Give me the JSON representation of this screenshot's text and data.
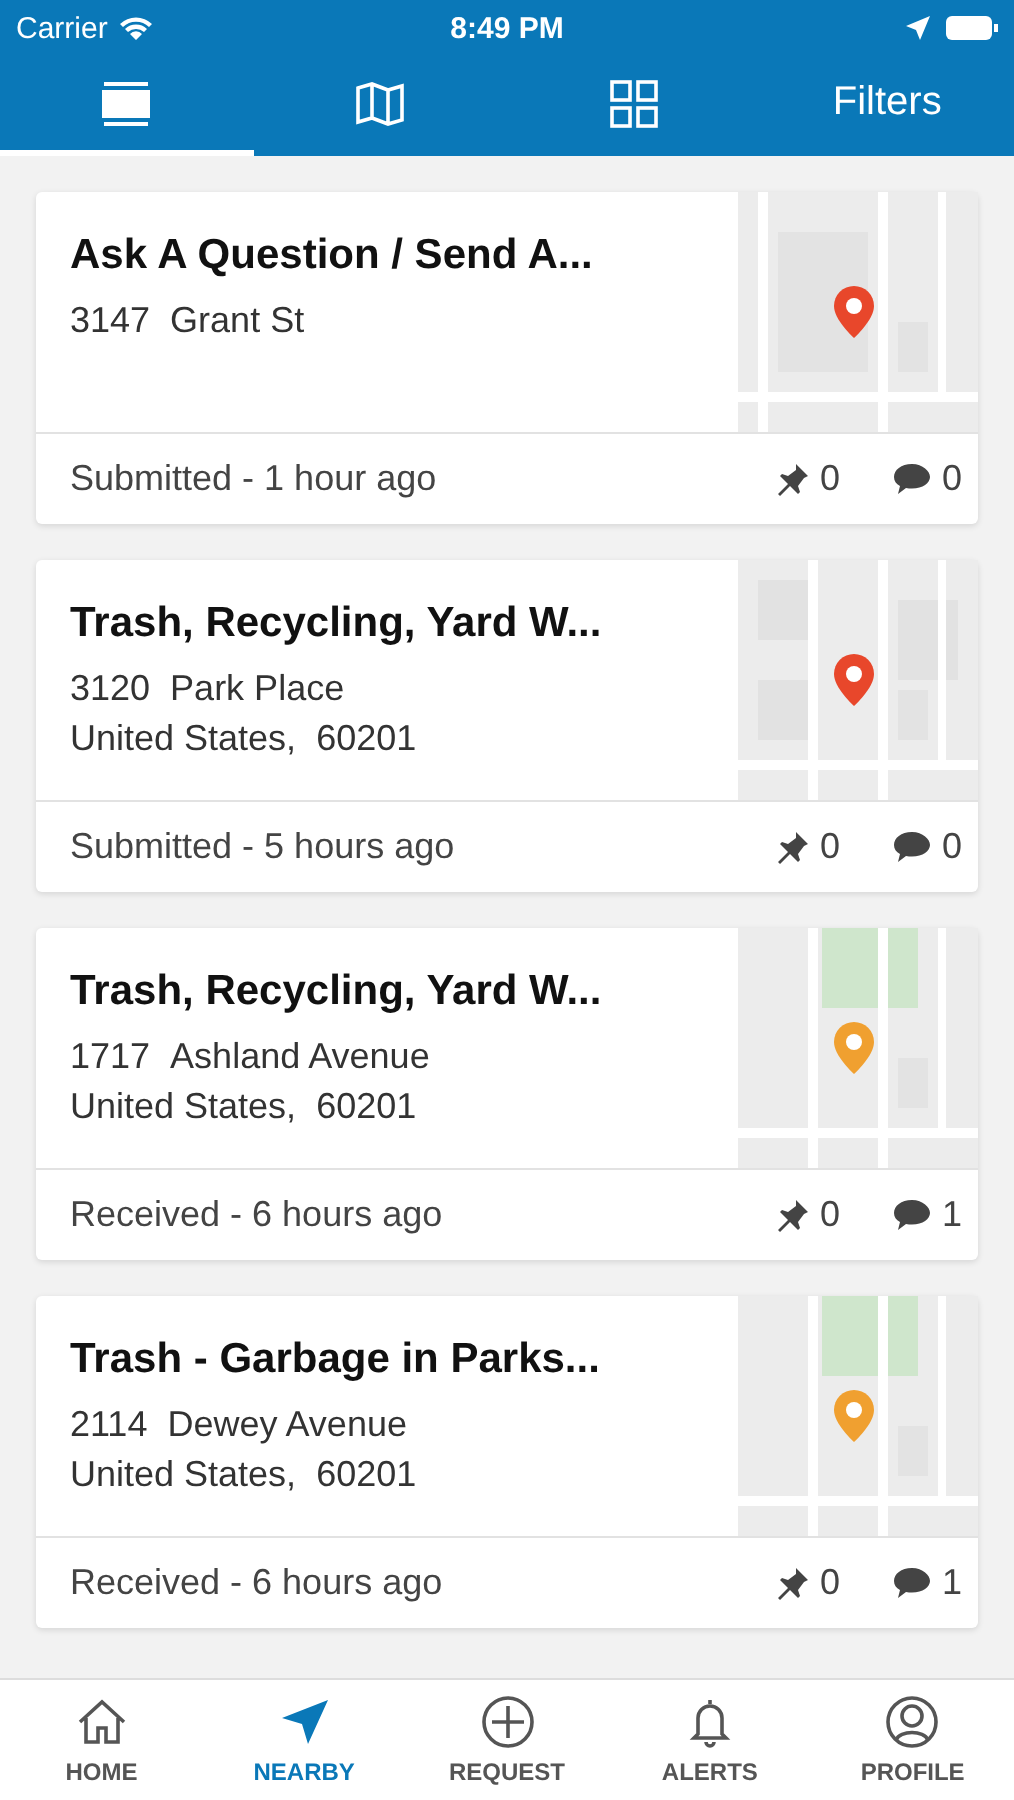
{
  "status_bar": {
    "carrier": "Carrier",
    "time": "8:49 PM"
  },
  "tabs": [
    {
      "kind": "list",
      "selected": true
    },
    {
      "kind": "map",
      "selected": false
    },
    {
      "kind": "grid",
      "selected": false
    },
    {
      "kind": "text",
      "label": "Filters",
      "selected": false
    }
  ],
  "requests": [
    {
      "title": "Ask A Question / Send A...",
      "number": "3147",
      "street": "Grant St",
      "status": "Submitted - 1 hour ago",
      "pins": "0",
      "comments": "0",
      "color": "#e8472b",
      "map": {
        "kind": "roads"
      }
    },
    {
      "title": "Trash, Recycling, Yard W...",
      "number": "3120",
      "street": "Park Place",
      "region": "United States,",
      "zip": "60201",
      "status": "Submitted - 5 hours ago",
      "pins": "0",
      "comments": "0",
      "color": "#e8472b",
      "map": {
        "kind": "blocks"
      }
    },
    {
      "title": "Trash, Recycling, Yard W...",
      "number": "1717",
      "street": "Ashland Avenue",
      "region": "United States,",
      "zip": "60201",
      "status": "Received - 6 hours ago",
      "pins": "0",
      "comments": "1",
      "color": "#f0a030",
      "map": {
        "kind": "park"
      }
    },
    {
      "title": "Trash - Garbage in Parks...",
      "number": "2114",
      "street": "Dewey Avenue",
      "region": "United States,",
      "zip": "60201",
      "status": "Received - 6 hours ago",
      "pins": "0",
      "comments": "1",
      "color": "#f0a030",
      "map": {
        "kind": "park"
      }
    }
  ],
  "bottom_nav": [
    {
      "kind": "home",
      "label": "HOME",
      "selected": false
    },
    {
      "kind": "nearby",
      "label": "NEARBY",
      "selected": true
    },
    {
      "kind": "request",
      "label": "REQUEST",
      "selected": false
    },
    {
      "kind": "alerts",
      "label": "ALERTS",
      "selected": false
    },
    {
      "kind": "profile",
      "label": "PROFILE",
      "selected": false
    }
  ]
}
